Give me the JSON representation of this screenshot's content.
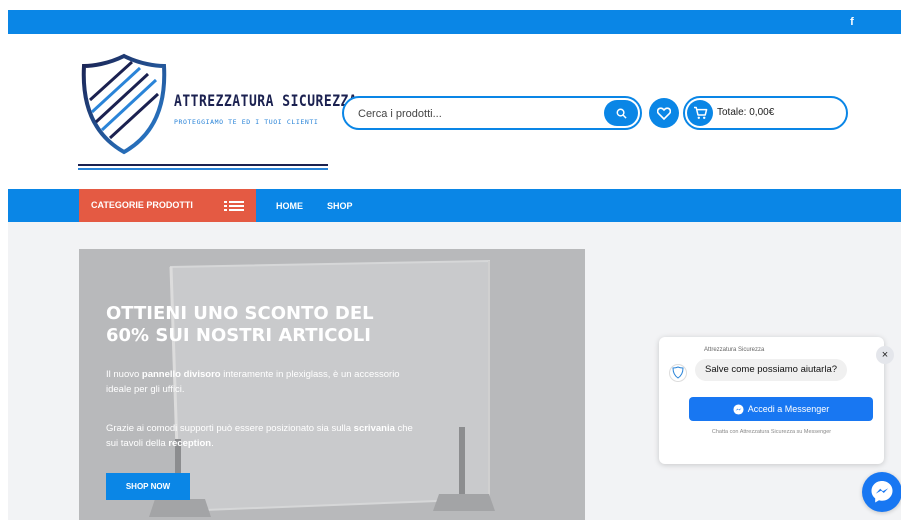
{
  "topbar": {
    "facebook_glyph": "f"
  },
  "logo": {
    "title": "ATTREZZATURA SICUREZZA",
    "subtitle": "PROTEGGIAMO TE ED I TUOI CLIENTI",
    "colors": {
      "navy": "#1b2150",
      "blue": "#2a84d8"
    }
  },
  "search": {
    "placeholder": "Cerca i prodotti..."
  },
  "wishlist": {
    "icon": "heart-icon"
  },
  "cart": {
    "total": "Totale: 0,00€",
    "icon": "cart-icon"
  },
  "nav": {
    "categories_label": "CATEGORIE PRODOTTI",
    "links": [
      {
        "label": "HOME"
      },
      {
        "label": "SHOP"
      }
    ]
  },
  "hero": {
    "title": "OTTIENI UNO SCONTO DEL 60% SUI NOSTRI ARTICOLI",
    "p1_pre": "Il nuovo ",
    "p1_bold": "pannello divisoro",
    "p1_post": " interamente in plexiglass, è un accessorio ideale per gli uffici.",
    "p2_pre": "Grazie ai comodi supporti può essere posizionato sia sulla ",
    "p2_bold1": "scrivania",
    "p2_mid": " che sui tavoli della ",
    "p2_bold2": "reception",
    "p2_post": ".",
    "cta": "SHOP NOW"
  },
  "chat": {
    "page_name": "Attrezzatura Sicurezza",
    "greeting": "Salve come possiamo aiutarla?",
    "button": "Accedi a Messenger",
    "note": "Chatta con Attrezzatura Sicurezza su Messenger",
    "close": "×"
  },
  "colors": {
    "primary": "#0a86e6",
    "category_button": "#e45a43",
    "messenger": "#1877f2",
    "content_bg": "#f2f3f5",
    "hero_bg": "#b8b9bb"
  }
}
